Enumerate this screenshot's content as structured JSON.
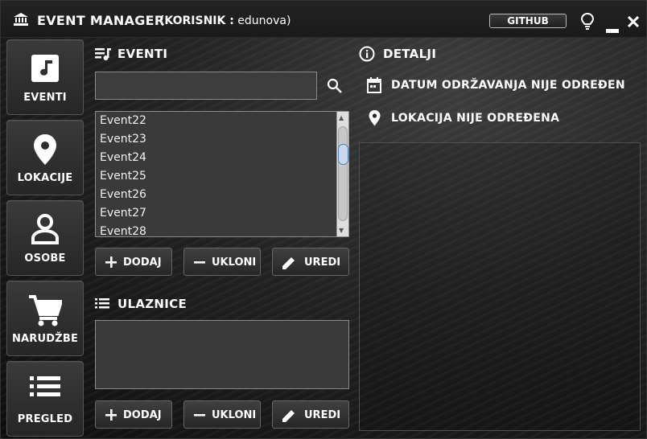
{
  "window": {
    "title": "EVENT MANAGER",
    "user_label": "(KORISNIK :",
    "user_name": "edunova)",
    "github_label": "GITHUB"
  },
  "nav": [
    {
      "label": "EVENTI",
      "icon": "music-note-icon"
    },
    {
      "label": "LOKACIJE",
      "icon": "location-pin-icon"
    },
    {
      "label": "OSOBE",
      "icon": "person-icon"
    },
    {
      "label": "NARUDŽBE",
      "icon": "shopping-cart-icon"
    },
    {
      "label": "PREGLED",
      "icon": "list-icon"
    }
  ],
  "events": {
    "heading": "EVENTI",
    "search_value": "",
    "items": [
      "Event22",
      "Event23",
      "Event24",
      "Event25",
      "Event26",
      "Event27",
      "Event28"
    ],
    "add_label": "DODAJ",
    "remove_label": "UKLONI",
    "edit_label": "UREDI"
  },
  "tickets": {
    "heading": "ULAZNICE",
    "add_label": "DODAJ",
    "remove_label": "UKLONI",
    "edit_label": "UREDI"
  },
  "details": {
    "heading": "DETALJI",
    "date_text": "DATUM ODRŽAVANJA NIJE ODREĐEN",
    "location_text": "LOKACIJA NIJE ODREĐENA"
  }
}
